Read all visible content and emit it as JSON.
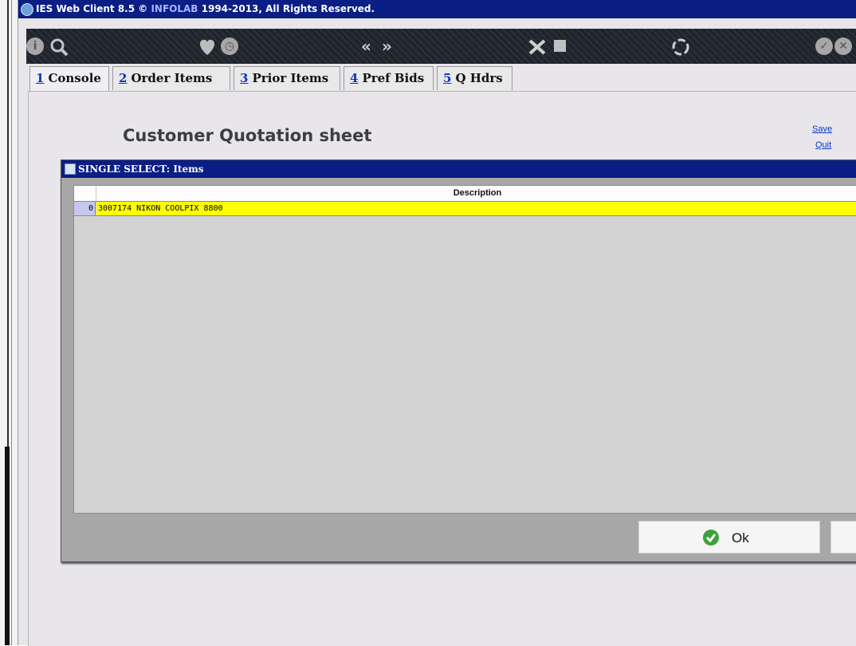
{
  "window": {
    "title_prefix": "IES Web Client 8.5 © ",
    "title_brand": "INFOLAB",
    "title_suffix": " 1994-2013, All Rights Reserved."
  },
  "toolbar": {
    "icons": [
      "info-icon",
      "search-icon",
      "heart-icon",
      "clock-icon",
      "prev-icon",
      "next-icon",
      "tools-icon",
      "stop-icon",
      "recycle-icon",
      "confirm-icon",
      "close-icon"
    ]
  },
  "tabs": [
    {
      "num": "1",
      "label": "Console",
      "active": true
    },
    {
      "num": "2",
      "label": "Order Items",
      "active": false
    },
    {
      "num": "3",
      "label": "Prior Items",
      "active": false
    },
    {
      "num": "4",
      "label": "Pref Bids",
      "active": false
    },
    {
      "num": "5",
      "label": "Q Hdrs",
      "active": false
    }
  ],
  "page": {
    "title": "Customer Quotation sheet",
    "save_link": "Save",
    "quit_link": "Quit"
  },
  "dialog": {
    "title": "SINGLE SELECT: Items",
    "grid": {
      "columns": [
        "Description"
      ],
      "rows": [
        {
          "index": "0",
          "description": "3007174 NIKON COOLPIX 8800"
        }
      ]
    },
    "ok_label": "Ok"
  },
  "colors": {
    "titlebar": "#0b1e86",
    "selected_row": "#ffff00",
    "link": "#0a35c6",
    "ok_icon": "#3aa33a"
  }
}
